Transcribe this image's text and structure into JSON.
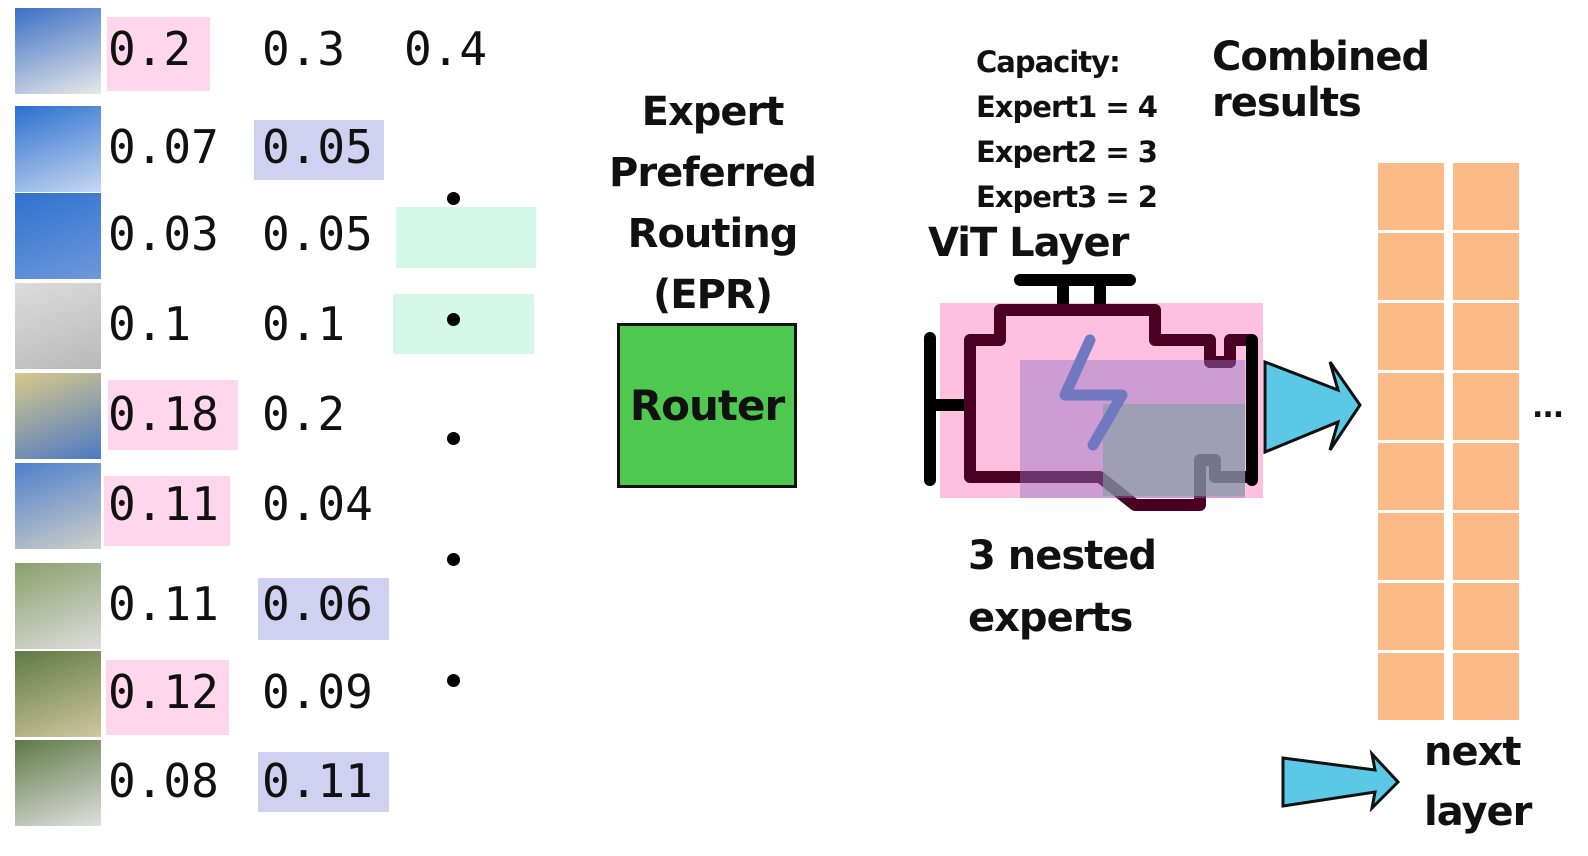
{
  "rows": [
    {
      "values": [
        "0.2",
        "0.3",
        "0.4"
      ]
    },
    {
      "values": [
        "0.07",
        "0.05",
        ""
      ]
    },
    {
      "values": [
        "0.03",
        "0.05",
        ""
      ]
    },
    {
      "values": [
        "0.1",
        "0.1",
        ""
      ]
    },
    {
      "values": [
        "0.18",
        "0.2",
        ""
      ]
    },
    {
      "values": [
        "0.11",
        "0.04",
        ""
      ]
    },
    {
      "values": [
        "0.11",
        "0.06",
        ""
      ]
    },
    {
      "values": [
        "0.12",
        "0.09",
        ""
      ]
    },
    {
      "values": [
        "0.08",
        "0.11",
        ""
      ]
    }
  ],
  "epr_title": [
    "Expert",
    "Preferred",
    "Routing",
    "(EPR)"
  ],
  "router_label": "Router",
  "capacity": [
    "Capacity:",
    "Expert1 = 4",
    "Expert2 = 3",
    "Expert3 = 2"
  ],
  "vit_layer": "ViT Layer",
  "nested_experts": [
    "3 nested",
    "experts"
  ],
  "combined_results": "Combined results",
  "ellipsis": "...",
  "next_layer": [
    "next",
    "layer"
  ],
  "colors": {
    "expert1": "#ffd6ec",
    "expert2": "#d0d0f0",
    "expert3": "#d4f7ea",
    "router": "#4fc84f",
    "arrow": "#5bc8e6",
    "token": "#fcbb86"
  }
}
